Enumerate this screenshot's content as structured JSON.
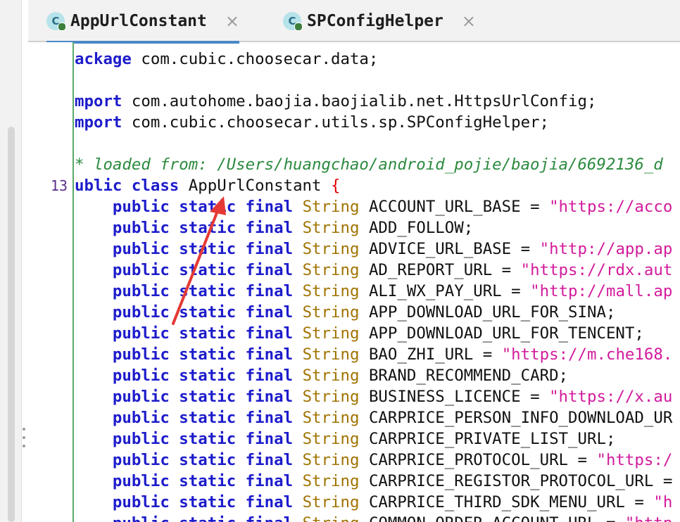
{
  "tabs": [
    {
      "label": "AppUrlConstant",
      "icon_letter": "C",
      "close": "×",
      "active": true
    },
    {
      "label": "SPConfigHelper",
      "icon_letter": "C",
      "close": "×",
      "active": false
    }
  ],
  "gutter": {
    "line_number": "13"
  },
  "code": {
    "package": {
      "kw": "ackage",
      "rest": " com.cubic.choosecar.data;"
    },
    "imports": [
      {
        "kw": "mport",
        "rest": " com.autohome.baojia.baojialib.net.HttpsUrlConfig;"
      },
      {
        "kw": "mport",
        "rest": " com.cubic.choosecar.utils.sp.SPConfigHelper;"
      }
    ],
    "comment": "* loaded from: /Users/huangchao/android_pojie/baojia/6692136_d",
    "class_decl": {
      "kw1": "ublic",
      "kw2": "class",
      "name": "AppUrlConstant",
      "brace": "{"
    },
    "field_modifiers": {
      "public": "public",
      "static": "static",
      "final": "final",
      "type": "String"
    },
    "fields": [
      {
        "name": "ACCOUNT_URL_BASE",
        "assign": " = ",
        "value": "\"https://acco"
      },
      {
        "name": "ADD_FOLLOW",
        "assign": "",
        "value": "",
        "end": ";"
      },
      {
        "name": "ADVICE_URL_BASE",
        "assign": " = ",
        "value": "\"http://app.ap"
      },
      {
        "name": "AD_REPORT_URL",
        "assign": " = ",
        "value": "\"https://rdx.aut"
      },
      {
        "name": "ALI_WX_PAY_URL",
        "assign": " = ",
        "value": "\"http://mall.ap"
      },
      {
        "name": "APP_DOWNLOAD_URL_FOR_SINA",
        "assign": "",
        "value": "",
        "end": ";"
      },
      {
        "name": "APP_DOWNLOAD_URL_FOR_TENCENT",
        "assign": "",
        "value": "",
        "end": ";"
      },
      {
        "name": "BAO_ZHI_URL",
        "assign": " = ",
        "value": "\"https://m.che168."
      },
      {
        "name": "BRAND_RECOMMEND_CARD",
        "assign": "",
        "value": "",
        "end": ";"
      },
      {
        "name": "BUSINESS_LICENCE",
        "assign": " = ",
        "value": "\"https://x.au"
      },
      {
        "name": "CARPRICE_PERSON_INFO_DOWNLOAD_UR",
        "assign": "",
        "value": ""
      },
      {
        "name": "CARPRICE_PRIVATE_LIST_URL",
        "assign": "",
        "value": "",
        "end": ";"
      },
      {
        "name": "CARPRICE_PROTOCOL_URL",
        "assign": " = ",
        "value": "\"https:/"
      },
      {
        "name": "CARPRICE_REGISTOR_PROTOCOL_URL",
        "assign": " =",
        "value": ""
      },
      {
        "name": "CARPRICE_THIRD_SDK_MENU_URL",
        "assign": " = ",
        "value": "\"h"
      },
      {
        "name": "COMMON_ORDER_ACCOUNT_URL",
        "assign": " = ",
        "value": "\"http"
      }
    ]
  },
  "annotation": {
    "color": "#e53935"
  }
}
